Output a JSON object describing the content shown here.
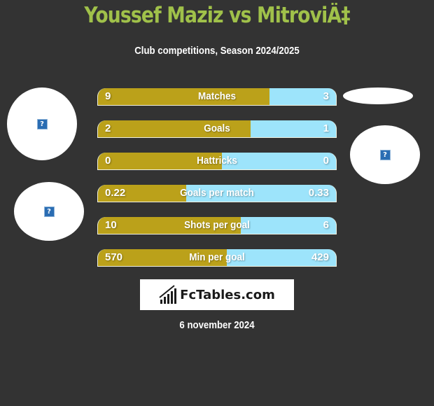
{
  "header": {
    "title": "Youssef Maziz vs MitroviÄ‡",
    "subtitle": "Club competitions, Season 2024/2025"
  },
  "players": {
    "left": {
      "avatar_icon": "broken-image-icon",
      "placeholder_glyph": "?"
    },
    "left_club": {
      "avatar_icon": "broken-image-icon",
      "placeholder_glyph": "?"
    },
    "right": {
      "avatar_icon": "broken-image-icon",
      "placeholder_glyph": "?"
    }
  },
  "colors": {
    "title": "#a0c14a",
    "left_bar": "#bba11a",
    "right_bar": "#9de4fb",
    "background": "#333333"
  },
  "stats": [
    {
      "label": "Matches",
      "left": "9",
      "right": "3",
      "left_share": 0.72
    },
    {
      "label": "Goals",
      "left": "2",
      "right": "1",
      "left_share": 0.64
    },
    {
      "label": "Hattricks",
      "left": "0",
      "right": "0",
      "left_share": 0.52
    },
    {
      "label": "Goals per match",
      "left": "0.22",
      "right": "0.33",
      "left_share": 0.37
    },
    {
      "label": "Shots per goal",
      "left": "10",
      "right": "6",
      "left_share": 0.6
    },
    {
      "label": "Min per goal",
      "left": "570",
      "right": "429",
      "left_share": 0.54
    }
  ],
  "logo": {
    "icon": "bar-chart-icon",
    "text": "FcTables.com"
  },
  "footer": {
    "date": "6 november 2024"
  }
}
